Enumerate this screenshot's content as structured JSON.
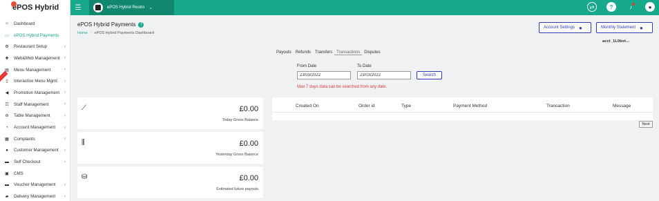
{
  "app": {
    "logo": "ePOS Hybrid",
    "store": "ePOS Hybrid Restro"
  },
  "sidebar": {
    "items": [
      {
        "label": "Dashboard",
        "icon": "home-icon",
        "chev": false,
        "active": false
      },
      {
        "label": "ePOS Hybrid Payments",
        "icon": "card-icon",
        "chev": false,
        "active": true
      },
      {
        "label": "Restaurant Setup",
        "icon": "gear-icon",
        "chev": true,
        "active": false
      },
      {
        "label": "Web&Mob Management",
        "icon": "plus-icon",
        "chev": true,
        "active": false
      },
      {
        "label": "Menu Management",
        "icon": "menu-icon",
        "chev": true,
        "active": false
      },
      {
        "label": "Interactive Menu Mgmt",
        "icon": "tablet-icon",
        "chev": true,
        "active": false
      },
      {
        "label": "Promotion Management",
        "icon": "megaphone-icon",
        "chev": true,
        "active": false
      },
      {
        "label": "Staff Management",
        "icon": "users-icon",
        "chev": true,
        "active": false
      },
      {
        "label": "Table Management",
        "icon": "table-icon",
        "chev": true,
        "active": false
      },
      {
        "label": "Account Management",
        "icon": "chart-icon",
        "chev": true,
        "active": false
      },
      {
        "label": "Complaints",
        "icon": "doc-icon",
        "chev": true,
        "active": false
      },
      {
        "label": "Customer Management",
        "icon": "user-icon",
        "chev": true,
        "active": false
      },
      {
        "label": "Self Checkout",
        "icon": "cart-icon",
        "chev": true,
        "active": false
      },
      {
        "label": "CMS",
        "icon": "cms-icon",
        "chev": false,
        "active": false
      },
      {
        "label": "Voucher Management",
        "icon": "voucher-icon",
        "chev": true,
        "active": false
      },
      {
        "label": "Delivery Management",
        "icon": "truck-icon",
        "chev": true,
        "active": false
      }
    ]
  },
  "page": {
    "title": "ePOS Hybrid Payments",
    "crumb_home": "Home",
    "crumb_current": "ePOS Hybrid Payments Dashboard",
    "account_settings": "Account Settings",
    "monthly_statement": "Monthly Statement",
    "acct_id": "acct_1L0bvt..."
  },
  "tabs": [
    "Payouts",
    "Refunds",
    "Transfers",
    "Transactions",
    "Disputes"
  ],
  "filters": {
    "from_label": "From Date",
    "from_value": "23/03/2022",
    "to_label": "To Date",
    "to_value": "23/03/2022",
    "search_label": "Search",
    "warning": "Max 7 days data can be searched from any date."
  },
  "cards": [
    {
      "amount": "£0.00",
      "caption": "Today Gross Balance",
      "icon": "trend-icon"
    },
    {
      "amount": "£0.00",
      "caption": "Yesterday Gross Balance",
      "icon": "bar-growth-icon"
    },
    {
      "amount": "£0.00",
      "caption": "Estimated future payouts",
      "icon": "money-hand-icon"
    }
  ],
  "table": {
    "headers": [
      "Created On",
      "Order id",
      "Type",
      "Payment Method",
      "Transaction",
      "Message"
    ],
    "next_label": "Next"
  },
  "colors": {
    "brand": "#17a98c",
    "accent": "#2d3bb8",
    "warning": "#e53935"
  }
}
